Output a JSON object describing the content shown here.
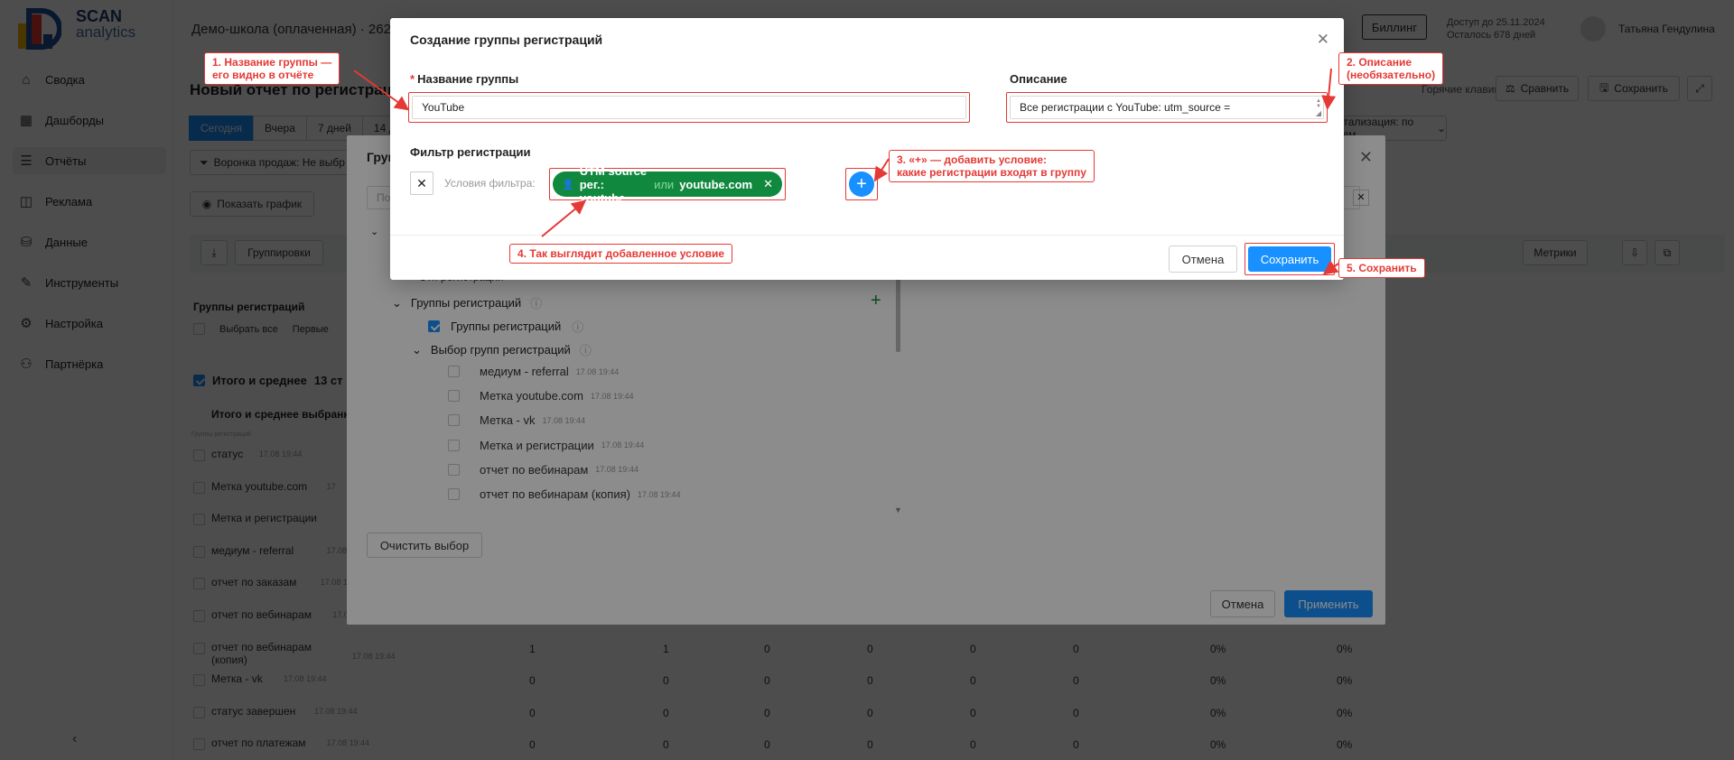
{
  "brand": {
    "name_top": "SCAN",
    "name_bottom": "analytics"
  },
  "sidebar": {
    "items": [
      {
        "label": "Сводка",
        "icon": "home-icon"
      },
      {
        "label": "Дашборды",
        "icon": "dashboard-icon"
      },
      {
        "label": "Отчёты",
        "icon": "reports-icon"
      },
      {
        "label": "Реклама",
        "icon": "ads-icon"
      },
      {
        "label": "Данные",
        "icon": "data-icon"
      },
      {
        "label": "Инструменты",
        "icon": "tools-icon"
      },
      {
        "label": "Настройка",
        "icon": "settings-icon"
      },
      {
        "label": "Партнёрка",
        "icon": "partner-icon"
      }
    ],
    "active_index": 2
  },
  "header": {
    "school": "Демо-школа (оплаченная) · 262",
    "billing_label": "Биллинг",
    "access_line1": "Доступ до 25.11.2024",
    "access_line2": "Осталось 678 дней",
    "user_name": "Татьяна Гендулина"
  },
  "report": {
    "title": "Новый отчет по регистрациям",
    "hotkeys_label": "Горячие клавиши",
    "compare_label": "Сравнить",
    "save_label": "Сохранить",
    "period_tabs": [
      "Сегодня",
      "Вчера",
      "7 дней",
      "14 д"
    ],
    "grouping_label": "Детализация: по дням",
    "funnel_label": "Воронка продаж: Не выбр",
    "show_chart_label": "Показать график",
    "groupings_btn": "Группировки",
    "metrics_btn": "Метрики",
    "groups_header": "Группы регистраций",
    "select_all": "Выбрать все",
    "first": "Первые",
    "total_label": "Итого и среднее",
    "total_count": "13 ст",
    "total_sub": "Итого и среднее выбранн",
    "tiny_label": "Группы регистраций"
  },
  "table_rows": [
    {
      "name": "статус",
      "ts": "17.08 19:44",
      "vals": []
    },
    {
      "name": "Метка youtube.com",
      "ts": "17",
      "vals": []
    },
    {
      "name": "Метка и регистрации",
      "ts": "",
      "vals": []
    },
    {
      "name": "медиум - referral",
      "ts": "17.08 19:44",
      "vals": []
    },
    {
      "name": "отчет по заказам",
      "ts": "17.08 19:44",
      "vals": []
    },
    {
      "name": "отчет по вебинарам",
      "ts": "17.08 19:44",
      "vals": []
    },
    {
      "name": "отчет по вебинарам (копия)",
      "ts": "17.08 19:44",
      "vals": [
        "1",
        "1",
        "0",
        "0",
        "0",
        "0",
        "0%",
        "0%"
      ]
    },
    {
      "name": "Метка - vk",
      "ts": "17.08 19:44",
      "vals": [
        "0",
        "0",
        "0",
        "0",
        "0",
        "0",
        "0%",
        "0%"
      ]
    },
    {
      "name": "статус завершен",
      "ts": "17.08 19:44",
      "vals": [
        "0",
        "0",
        "0",
        "0",
        "0",
        "0",
        "0%",
        "0%"
      ]
    },
    {
      "name": "отчет по платежам",
      "ts": "17.08 19:44",
      "vals": [
        "0",
        "0",
        "0",
        "0",
        "0",
        "0",
        "0%",
        "0%"
      ]
    }
  ],
  "group_panel": {
    "title_fragment": "Груп",
    "search_placeholder": "По",
    "tree_hidden": "Этп регистрации",
    "tree_groups": "Группы регистраций",
    "tree_groups_child": "Группы регистраций",
    "tree_selection": "Выбор групп регистраций",
    "items": [
      {
        "name": "медиум - referral",
        "ts": "17.08 19:44"
      },
      {
        "name": "Метка youtube.com",
        "ts": "17.08 19:44"
      },
      {
        "name": "Метка - vk",
        "ts": "17.08 19:44"
      },
      {
        "name": "Метка и регистрации",
        "ts": "17.08 19:44"
      },
      {
        "name": "отчет по вебинарам",
        "ts": "17.08 19:44"
      },
      {
        "name": "отчет по вебинарам (копия)",
        "ts": "17.08 19:44"
      }
    ],
    "clear_label": "Очистить выбор",
    "cancel_label": "Отмена",
    "apply_label": "Применить"
  },
  "modal": {
    "title": "Создание группы регистраций",
    "name_label": "Название группы",
    "name_value": "YouTube",
    "desc_label": "Описание",
    "desc_value": "Все регистрации с YouTube: utm_source =",
    "filter_label": "Фильтр регистрации",
    "conditions_label": "Условия фильтра:",
    "tag_prefix": "UTM source рег.: youtube",
    "tag_or": "или",
    "tag_suffix": "youtube.com",
    "cancel_label": "Отмена",
    "save_label": "Сохранить"
  },
  "callouts": {
    "c1_line1": "1. Название группы —",
    "c1_line2": "его видно в отчёте",
    "c2_line1": "2. Описание",
    "c2_line2": "(необязательно)",
    "c3_line1": "3. «+» — добавить условие:",
    "c3_line2": "какие регистрации входят в группу",
    "c4": "4. Так выглядит добавленное условие",
    "c5": "5. Сохранить"
  },
  "colors": {
    "accent": "#1890ff",
    "tag_green": "#10893e",
    "annotation_red": "#e53935",
    "brand_blue": "#1f4e9e"
  }
}
